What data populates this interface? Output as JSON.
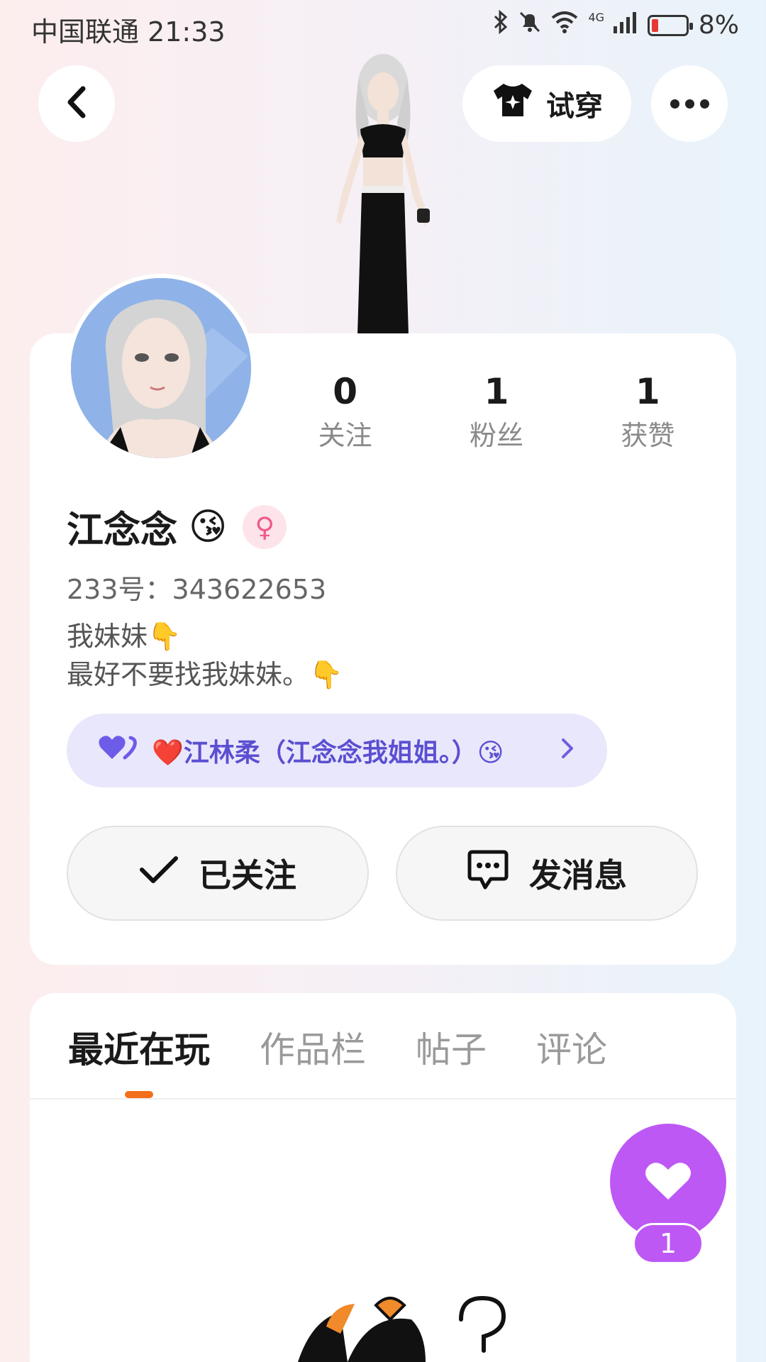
{
  "status_bar": {
    "carrier_time": "中国联通 21:33",
    "network": "4G",
    "battery": "8%",
    "icons": [
      "bluetooth-icon",
      "mute-icon",
      "wifi-icon",
      "signal-icon",
      "battery-icon"
    ]
  },
  "header": {
    "try_on_label": "试穿",
    "icons": [
      "back-icon",
      "shirt-icon",
      "more-icon"
    ]
  },
  "profile": {
    "stats": [
      {
        "value": "0",
        "label": "关注"
      },
      {
        "value": "1",
        "label": "粉丝"
      },
      {
        "value": "1",
        "label": "获赞"
      }
    ],
    "name": "江念念",
    "name_emoji": "😘",
    "gender_symbol": "♀",
    "uid": "233号：343622653",
    "bio_line1": "我妹妹👇",
    "bio_line2": "最好不要找我妹妹。👇",
    "relation_text": "❤️江林柔（江念念我姐姐。）😘",
    "follow_label": "已关注",
    "message_label": "发消息"
  },
  "tabs": [
    {
      "label": "最近在玩",
      "active": true
    },
    {
      "label": "作品栏",
      "active": false
    },
    {
      "label": "帖子",
      "active": false
    },
    {
      "label": "评论",
      "active": false
    }
  ],
  "like": {
    "count": "1"
  },
  "colors": {
    "accent_orange": "#f36f1b",
    "relation_purple": "#5b4fd1",
    "like_purple": "#bd58f5",
    "gender_pink": "#ef5a88"
  }
}
